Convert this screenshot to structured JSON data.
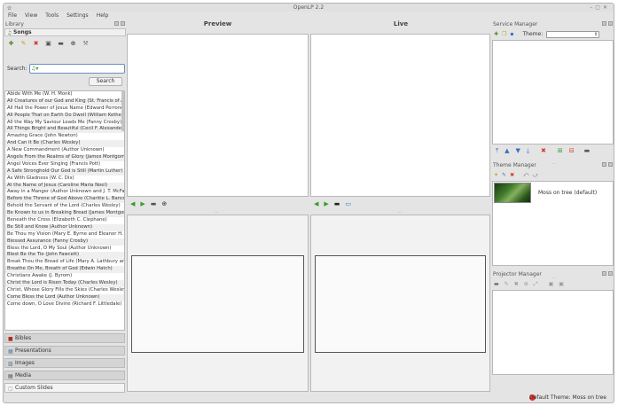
{
  "window": {
    "title": "OpenLP 2.2"
  },
  "menu": [
    "File",
    "View",
    "Tools",
    "Settings",
    "Help"
  ],
  "library": {
    "title": "Library",
    "active_section": "Songs",
    "search_label": "Search:",
    "search_value": "",
    "search_button": "Search",
    "songs": [
      "Abide With Me (W. H. Monk)",
      "All Creatures of our God and King (St. Francis of Assisi)",
      "All Hail the Power of Jesus Name (Edward Perronet)",
      "All People That on Earth Do Dwell (William Kethe)",
      "All the Way My Saviour Leads Me (Fanny Crosby)",
      "All Things Bright and Beautiful (Cecil F. Alexander)",
      "Amazing Grace (John Newton)",
      "And Can It Be (Charles Wesley)",
      "A New Commandment (Author Unknown)",
      "Angels From the Realms of Glory (James Montgomery)",
      "Angel Voices Ever Singing (Francis Pott)",
      "A Safe Stronghold Our God is Still (Martin Luther)",
      "As With Gladness (W. C. Dix)",
      "At the Name of Jesus (Caroline Maria Noel)",
      "Away in a Manger (Author Unknown and J. T. McFarland)",
      "Before the Throne of God Above (Charitie L. Bancroft)",
      "Behold the Servant of the Lord (Charles Wesley)",
      "Be Known to us in Breaking Bread (James Montgomery)",
      "Beneath the Cross (Elizabeth C. Clephane)",
      "Be Still and Know (Author Unknown)",
      "Be Thou my Vision (Mary E. Byrne and Eleanor H. Hull)",
      "Blessed Assurance (Fanny Crosby)",
      "Bless the Lord, O My Soul (Author Unknown)",
      "Blest Be the Tie (John Fawcett)",
      "Break Thou the Bread of Life (Mary A. Lathbury and A. Groves)",
      "Breathe On Me, Breath of God (Edwin Hatch)",
      "Christians Awake (J. Byrom)",
      "Christ the Lord is Risen Today (Charles Wesley)",
      "Christ, Whose Glory Fills the Skies (Charles Wesley)",
      "Come Bless the Lord (Author Unknown)",
      "Come down, O Love Divine (Richard F. Littledale)"
    ],
    "categories": [
      "Bibles",
      "Presentations",
      "Images",
      "Media",
      "Custom Slides"
    ]
  },
  "preview": {
    "title": "Preview"
  },
  "live": {
    "title": "Live"
  },
  "service_manager": {
    "title": "Service Manager",
    "theme_label": "Theme:",
    "theme_value": ""
  },
  "theme_manager": {
    "title": "Theme Manager",
    "themes": [
      {
        "name": "Moss on tree (default)"
      }
    ]
  },
  "projector_manager": {
    "title": "Projector Manager"
  },
  "status": {
    "default_theme": "Default Theme: Moss on tree"
  },
  "colors": {
    "accent_blue": "#3a6fc4",
    "nav_green": "#3a9a2a",
    "delete_red": "#d9362b"
  }
}
